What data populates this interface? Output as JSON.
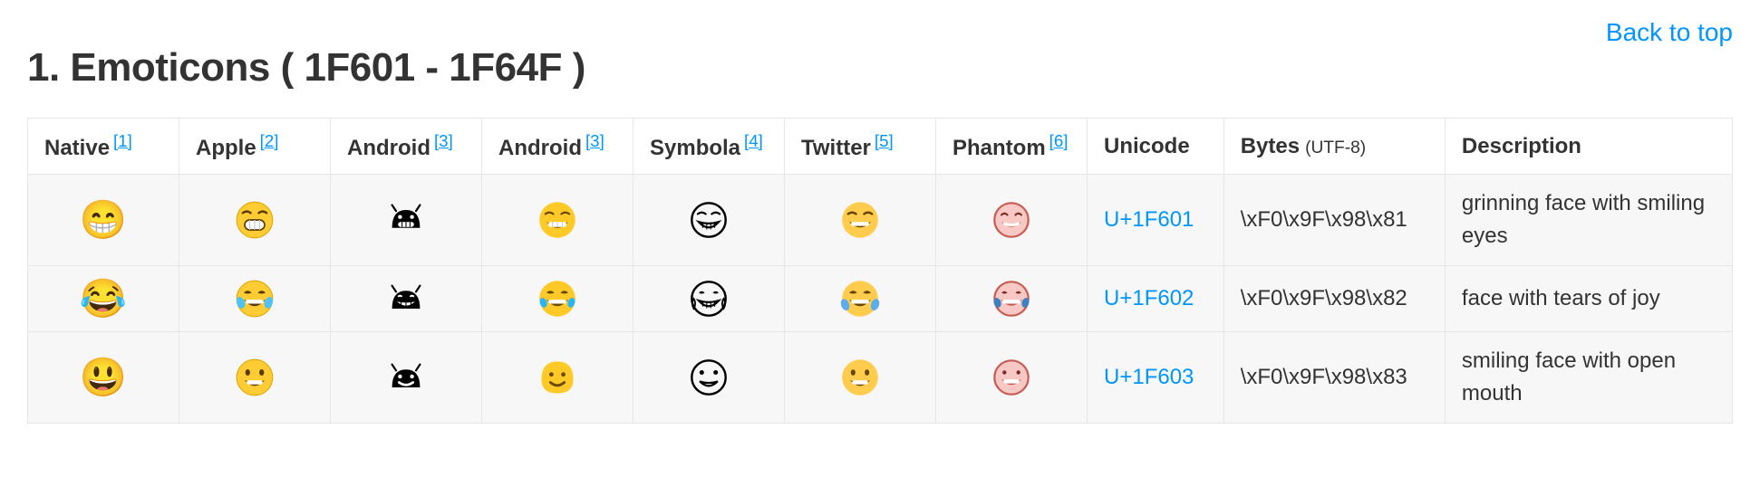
{
  "back_to_top": "Back to top",
  "heading": "1. Emoticons ( 1F601 - 1F64F )",
  "columns": [
    {
      "label": "Native",
      "ref": "[1]"
    },
    {
      "label": "Apple",
      "ref": "[2]"
    },
    {
      "label": "Android",
      "ref": "[3]"
    },
    {
      "label": "Android",
      "ref": "[3]"
    },
    {
      "label": "Symbola",
      "ref": "[4]"
    },
    {
      "label": "Twitter",
      "ref": "[5]"
    },
    {
      "label": "Phantom",
      "ref": "[6]"
    },
    {
      "label": "Unicode"
    },
    {
      "label": "Bytes",
      "sub": "(UTF-8)"
    },
    {
      "label": "Description"
    }
  ],
  "rows": [
    {
      "native": "😁",
      "codepoint": "U+1F601",
      "bytes": "\\xF0\\x9F\\x98\\x81",
      "description": "grinning face with smiling eyes",
      "icons": {
        "apple": "grin-teeth-yellow",
        "android_bw": "android-robot-teeth",
        "android_color": "yellow-grin-teeth",
        "symbola": "outline-grin-teeth",
        "twitter": "yellow-grin-teeth",
        "phantom": "pink-grin"
      }
    },
    {
      "native": "😂",
      "codepoint": "U+1F602",
      "bytes": "\\xF0\\x9F\\x98\\x82",
      "description": "face with tears of joy",
      "icons": {
        "apple": "joy-tears-yellow",
        "android_bw": "android-robot-laugh",
        "android_color": "yellow-joy-tears",
        "symbola": "outline-joy-tears",
        "twitter": "yellow-joy-tears",
        "phantom": "pink-joy-tears"
      }
    },
    {
      "native": "😃",
      "codepoint": "U+1F603",
      "bytes": "\\xF0\\x9F\\x98\\x83",
      "description": "smiling face with open mouth",
      "icons": {
        "apple": "open-mouth-smile-yellow",
        "android_bw": "android-robot-smile",
        "android_color": "yellow-blob-smile",
        "symbola": "outline-open-smile",
        "twitter": "yellow-open-smile",
        "phantom": "pink-open-smile"
      }
    }
  ]
}
